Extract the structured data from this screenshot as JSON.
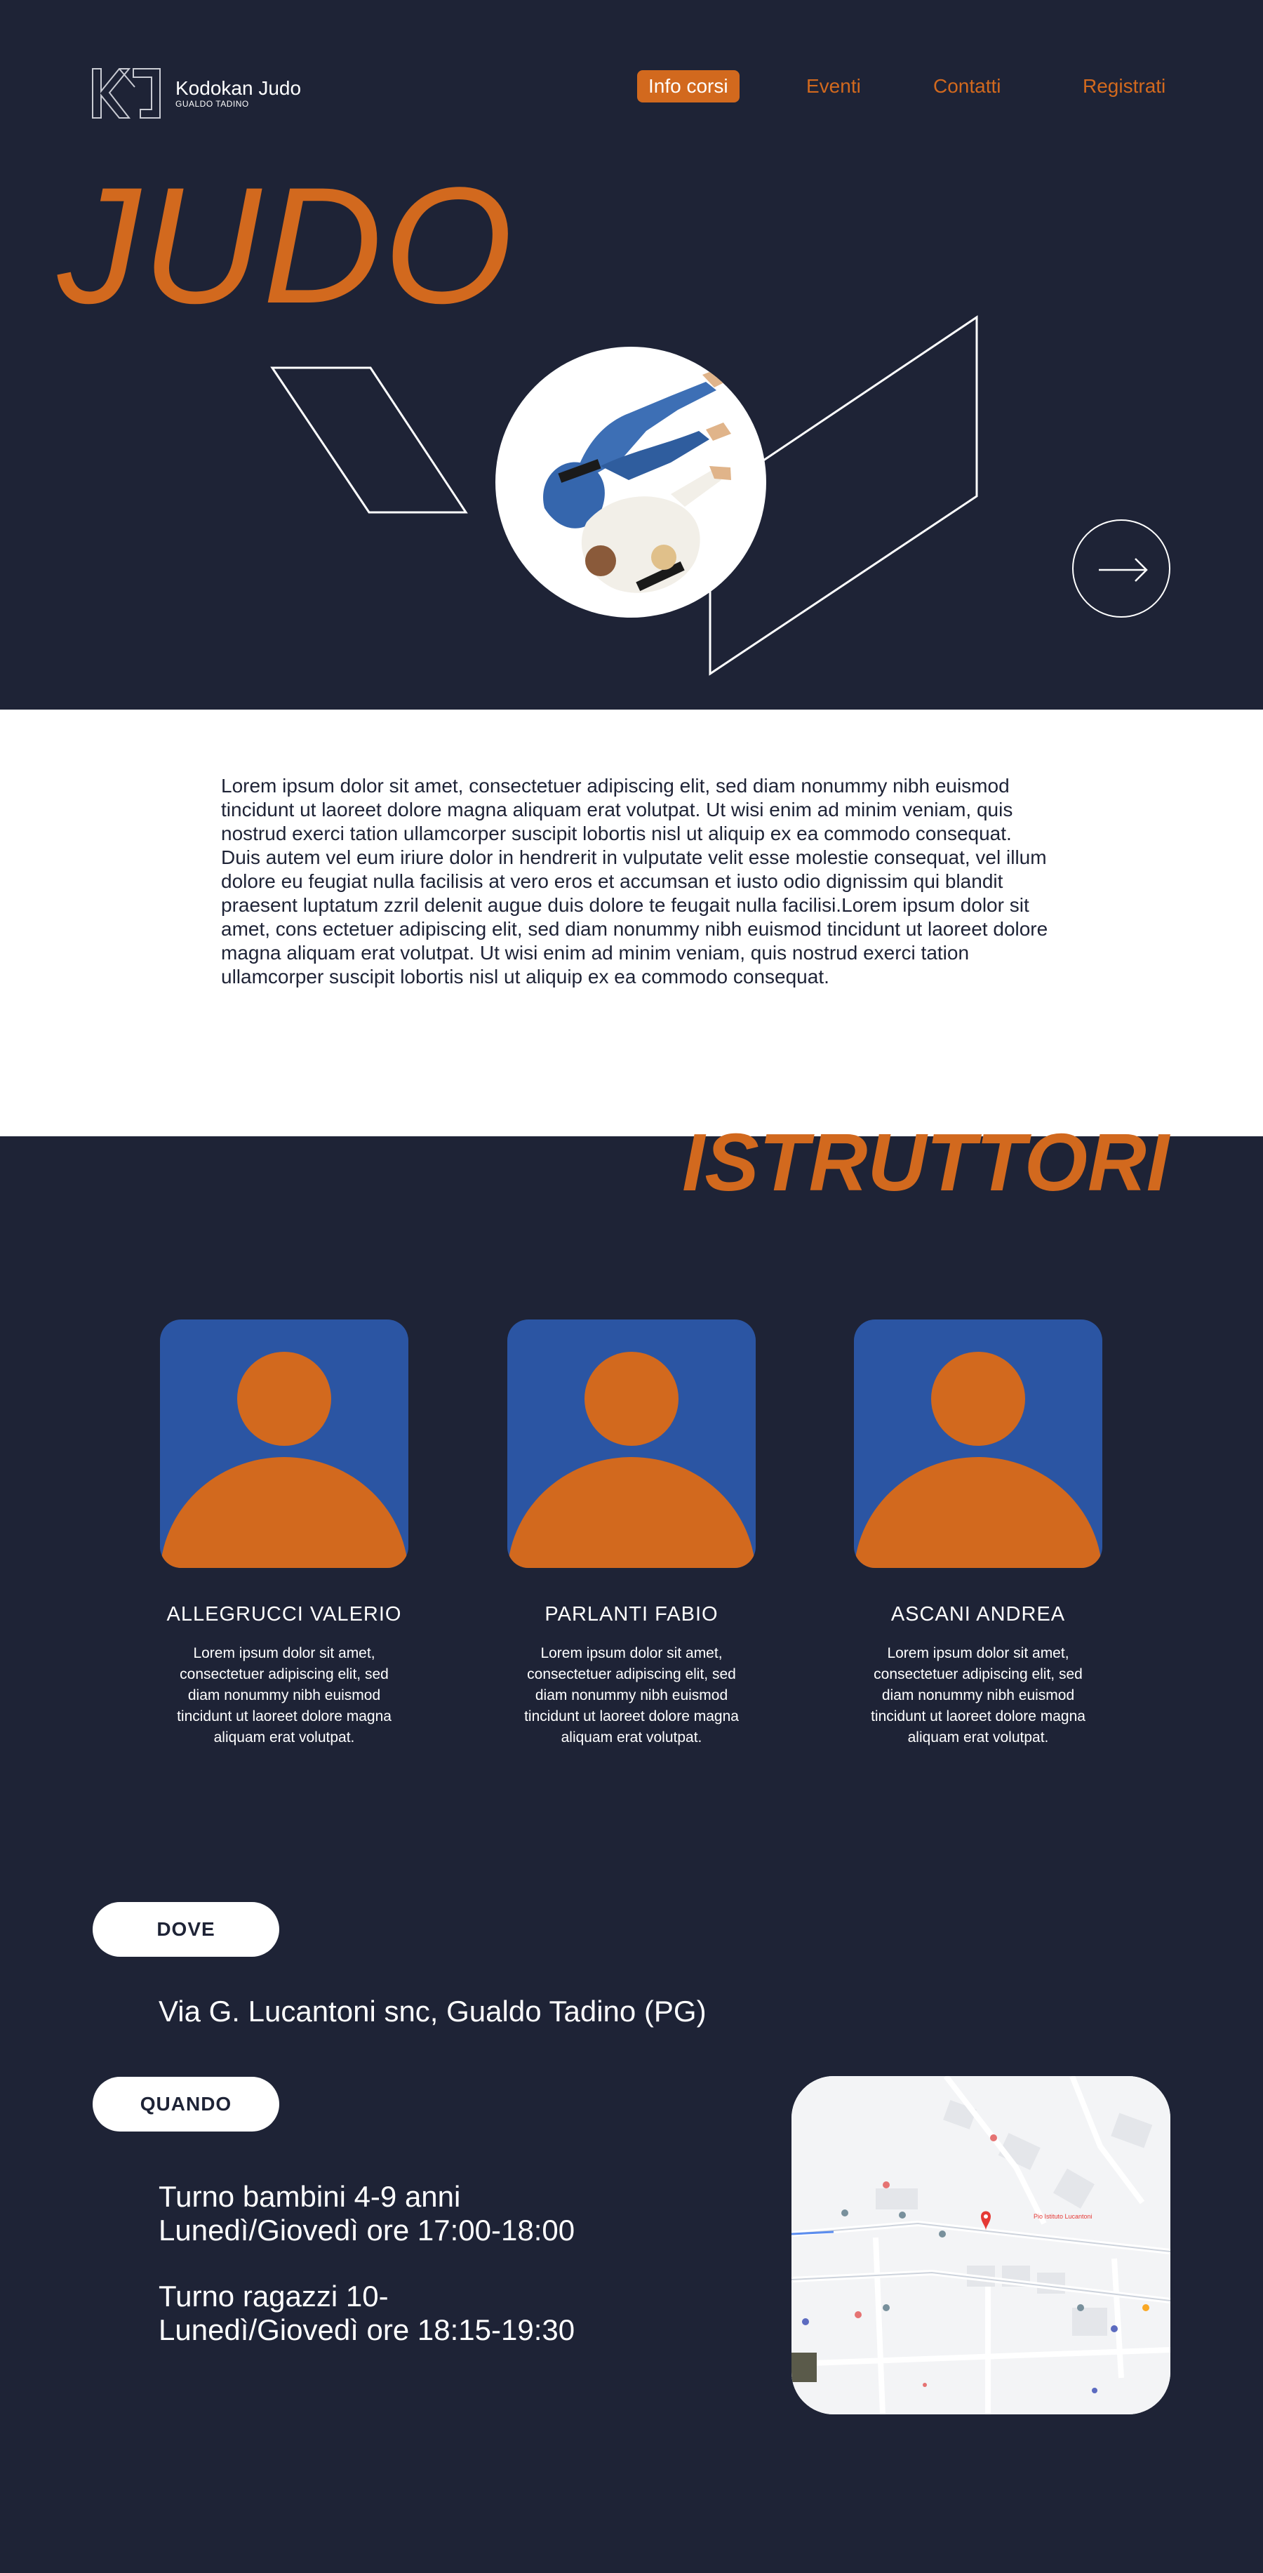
{
  "brand": {
    "name": "Kodokan Judo",
    "subtitle": "GUALDO TADINO"
  },
  "nav": {
    "items": [
      {
        "label": "Info corsi",
        "active": true
      },
      {
        "label": "Eventi",
        "active": false
      },
      {
        "label": "Contatti",
        "active": false
      },
      {
        "label": "Registrati",
        "active": false
      }
    ]
  },
  "hero": {
    "title": "JUDO"
  },
  "about": {
    "text": "Lorem ipsum dolor sit amet, consectetuer adipiscing elit, sed diam nonummy nibh euismod tincidunt ut laoreet dolore magna aliquam erat volutpat. Ut wisi enim ad minim veniam, quis nostrud exerci tation ullamcorper suscipit lobortis nisl ut aliquip ex ea commodo consequat.\nDuis autem vel eum iriure dolor in hendrerit in vulputate velit esse molestie consequat, vel illum dolore eu feugiat nulla facilisis at vero eros et accumsan et iusto odio dignissim qui blandit praesent luptatum zzril delenit augue duis dolore te feugait nulla facilisi.Lorem ipsum dolor sit amet, cons ectetuer adipiscing elit, sed diam nonummy nibh euismod tincidunt ut laoreet dolore magna aliquam erat volutpat. Ut wisi enim ad minim veniam, quis nostrud exerci tation ullamcorper suscipit lobortis nisl ut aliquip ex ea commodo consequat."
  },
  "instructors": {
    "title": "ISTRUTTORI",
    "items": [
      {
        "name": "ALLEGRUCCI VALERIO",
        "description": "Lorem ipsum dolor sit amet, consectetuer adipiscing elit, sed diam nonummy nibh euismod tincidunt ut laoreet dolore magna aliquam erat volutpat."
      },
      {
        "name": "PARLANTI FABIO",
        "description": "Lorem ipsum dolor sit amet, consectetuer adipiscing elit, sed diam nonummy nibh euismod tincidunt ut laoreet dolore magna aliquam erat volutpat."
      },
      {
        "name": "ASCANI ANDREA",
        "description": "Lorem ipsum dolor sit amet, consectetuer adipiscing elit, sed diam nonummy nibh euismod tincidunt ut laoreet dolore magna aliquam erat volutpat."
      }
    ]
  },
  "where": {
    "label": "DOVE",
    "address": "Via G. Lucantoni snc, Gualdo Tadino (PG)"
  },
  "when": {
    "label": "QUANDO",
    "schedules": [
      {
        "title": "Turno bambini 4-9 anni",
        "time": "Lunedì/Giovedì ore 17:00-18:00"
      },
      {
        "title": "Turno ragazzi 10-",
        "time": "Lunedì/Giovedì ore 18:15-19:30"
      }
    ]
  },
  "map": {
    "pin_label": "Pio Istituto Lucantoni"
  },
  "colors": {
    "background": "#1e2336",
    "accent": "#d2691e",
    "avatar": "#2b55a3",
    "light": "#ffffff"
  },
  "icons": {
    "next": "arrow-right-icon",
    "logo": "kj-logo-icon",
    "map_pin": "map-pin-icon"
  }
}
